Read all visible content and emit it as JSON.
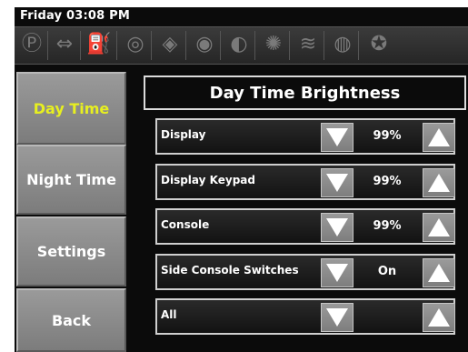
{
  "status": {
    "clock": "Friday 03:08 PM"
  },
  "icon_bar": {
    "icons": [
      "park-brake-icon",
      "turn-signal-icon",
      "fuel-icon",
      "engine-icon",
      "headlight-icon",
      "fog-light-icon",
      "lights-icon",
      "beacon-icon",
      "coolant-icon",
      "oil-icon",
      "seatbelt-icon"
    ]
  },
  "nav": {
    "day_time": "Day Time",
    "night_time": "Night Time",
    "settings": "Settings",
    "back": "Back"
  },
  "main": {
    "title": "Day Time Brightness",
    "rows": [
      {
        "label": "Display",
        "value": "99%"
      },
      {
        "label": "Display Keypad",
        "value": "99%"
      },
      {
        "label": "Console",
        "value": "99%"
      },
      {
        "label": "Side Console Switches",
        "value": "On"
      },
      {
        "label": "All",
        "value": ""
      }
    ]
  },
  "colors": {
    "active_nav_text": "#e7ef20",
    "button_gray": "#8a8a8a",
    "background": "#0b0b0b"
  }
}
